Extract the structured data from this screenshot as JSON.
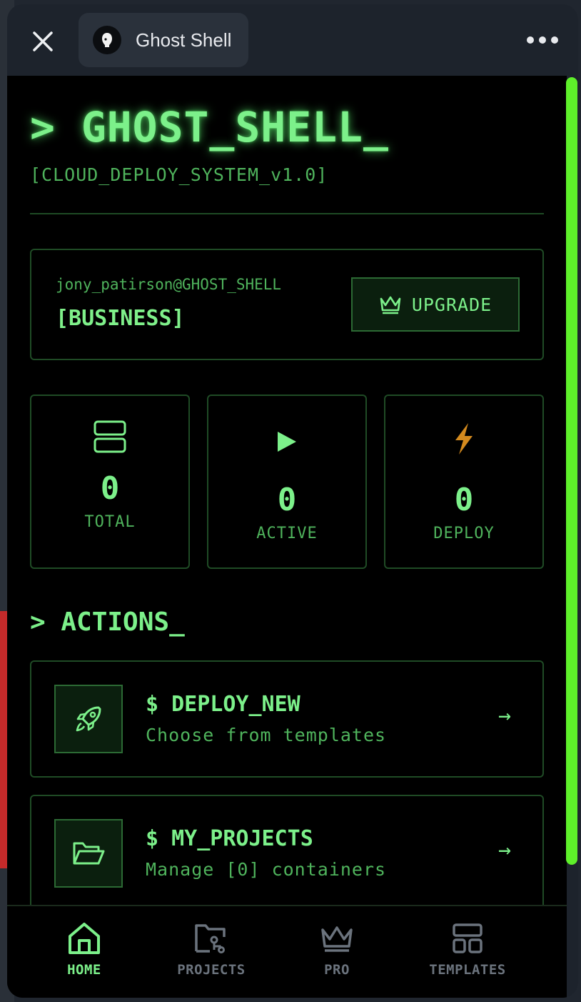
{
  "sheet": {
    "app_name": "Ghost Shell"
  },
  "app": {
    "title": "> GHOST_SHELL_",
    "subtitle": "[CLOUD_DEPLOY_SYSTEM_v1.0]",
    "user": {
      "email": "jony_patirson@GHOST_SHELL",
      "plan": "[BUSINESS]",
      "upgrade_label": "UPGRADE"
    },
    "stats": [
      {
        "value": "0",
        "label": "TOTAL",
        "icon": "server-icon"
      },
      {
        "value": "0",
        "label": "ACTIVE",
        "icon": "play-icon"
      },
      {
        "value": "0",
        "label": "DEPLOY",
        "icon": "lightning-icon"
      }
    ],
    "actions_title": "> ACTIONS_",
    "actions": [
      {
        "command": "$ DEPLOY_NEW",
        "description": "Choose from templates",
        "icon": "rocket-icon",
        "arrow": "→"
      },
      {
        "command": "$ MY_PROJECTS",
        "description": "Manage [0] containers",
        "icon": "folder-open-icon",
        "arrow": "→"
      }
    ],
    "nav": [
      {
        "label": "HOME",
        "icon": "home-icon",
        "active": true
      },
      {
        "label": "PROJECTS",
        "icon": "projects-icon",
        "active": false
      },
      {
        "label": "PRO",
        "icon": "crown-icon",
        "active": false
      },
      {
        "label": "TEMPLATES",
        "icon": "templates-icon",
        "active": false
      }
    ]
  },
  "colors": {
    "accent_green": "#7cf08a",
    "dim_green": "#4fb35c",
    "border_green": "#1f4b25",
    "scrollbar": "#5ef02a",
    "inactive_nav": "#6b737d"
  }
}
